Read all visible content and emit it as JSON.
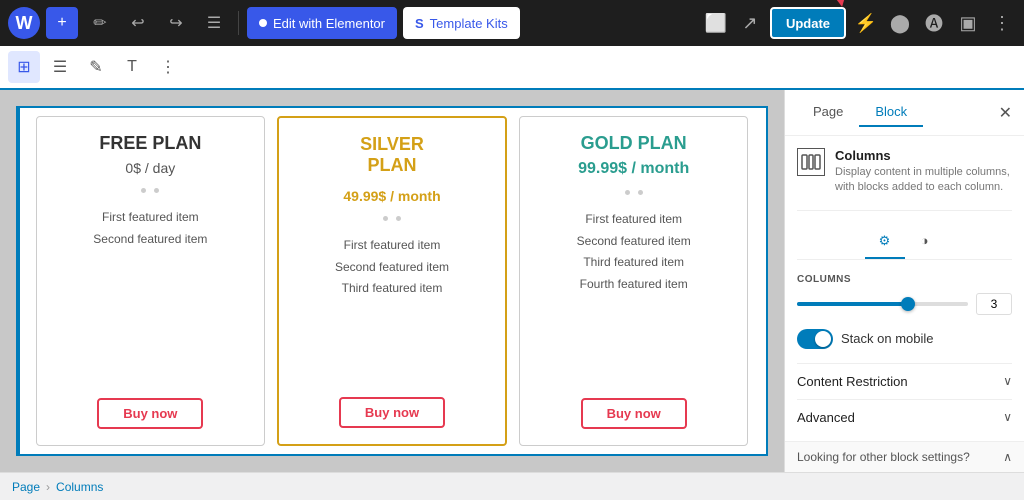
{
  "toolbar": {
    "add_label": "+",
    "edit_elementor_label": "Edit with Elementor",
    "template_kits_label": "Template Kits",
    "update_label": "Update"
  },
  "secondary_toolbar": {
    "layout_icon": "⊞",
    "align_icon": "☰",
    "style_icon": "✎",
    "text_icon": "T",
    "more_icon": "⋮"
  },
  "plans": [
    {
      "id": "free",
      "title": "FREE PLAN",
      "price": "0$ / day",
      "features": [
        "First featured item",
        "Second featured item"
      ],
      "button_label": "Buy now",
      "highlighted": false
    },
    {
      "id": "silver",
      "title": "SILVER PLAN",
      "price": "49.99$ / month",
      "features": [
        "First featured item",
        "Second featured item",
        "Third featured item"
      ],
      "button_label": "Buy now",
      "highlighted": true
    },
    {
      "id": "gold",
      "title": "GOLD PLAN",
      "price": "99.99$ / month",
      "features": [
        "First featured item",
        "Second featured item",
        "Third featured item",
        "Fourth featured item"
      ],
      "button_label": "Buy now",
      "highlighted": false
    }
  ],
  "right_panel": {
    "tab_page": "Page",
    "tab_block": "Block",
    "block_name": "Columns",
    "block_description": "Display content in multiple columns, with blocks added to each column.",
    "columns_label": "COLUMNS",
    "columns_value": "3",
    "stack_on_mobile_label": "Stack on mobile",
    "content_restriction_label": "Content Restriction",
    "advanced_label": "Advanced",
    "looking_for_label": "Looking for other block settings?"
  },
  "breadcrumb": {
    "page_label": "Page",
    "separator": "›",
    "columns_label": "Columns"
  }
}
